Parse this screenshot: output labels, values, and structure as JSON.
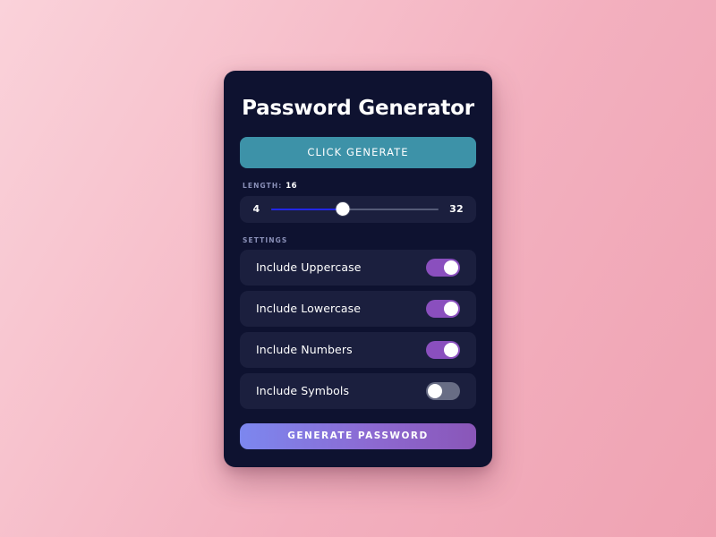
{
  "theme": {
    "page_background_start": "#fad2da",
    "page_background_end": "#efa2b2",
    "card_background": "#0e1230",
    "panel_background": "#1b1f3e",
    "accent_teal": "#3d92a8",
    "accent_purple": "#8a4fbe",
    "accent_blue": "#2226e6",
    "toggle_off_gray": "#686d85",
    "gradient_button_start": "#7c87ef",
    "gradient_button_end": "#8a56b8"
  },
  "card": {
    "title": "Password Generator",
    "display_button_label": "CLICK GENERATE",
    "generate_button_label": "GENERATE PASSWORD"
  },
  "length": {
    "label": "LENGTH:",
    "value": "16",
    "min_label": "4",
    "max_label": "32",
    "min": 4,
    "max": 32,
    "current": 16,
    "fill_percent": 43
  },
  "settings": {
    "label": "SETTINGS",
    "options": [
      {
        "label": "Include Uppercase",
        "state": "on",
        "name": "toggle-include-uppercase"
      },
      {
        "label": "Include Lowercase",
        "state": "on",
        "name": "toggle-include-lowercase"
      },
      {
        "label": "Include Numbers",
        "state": "on",
        "name": "toggle-include-numbers"
      },
      {
        "label": "Include Symbols",
        "state": "off",
        "name": "toggle-include-symbols"
      }
    ]
  }
}
